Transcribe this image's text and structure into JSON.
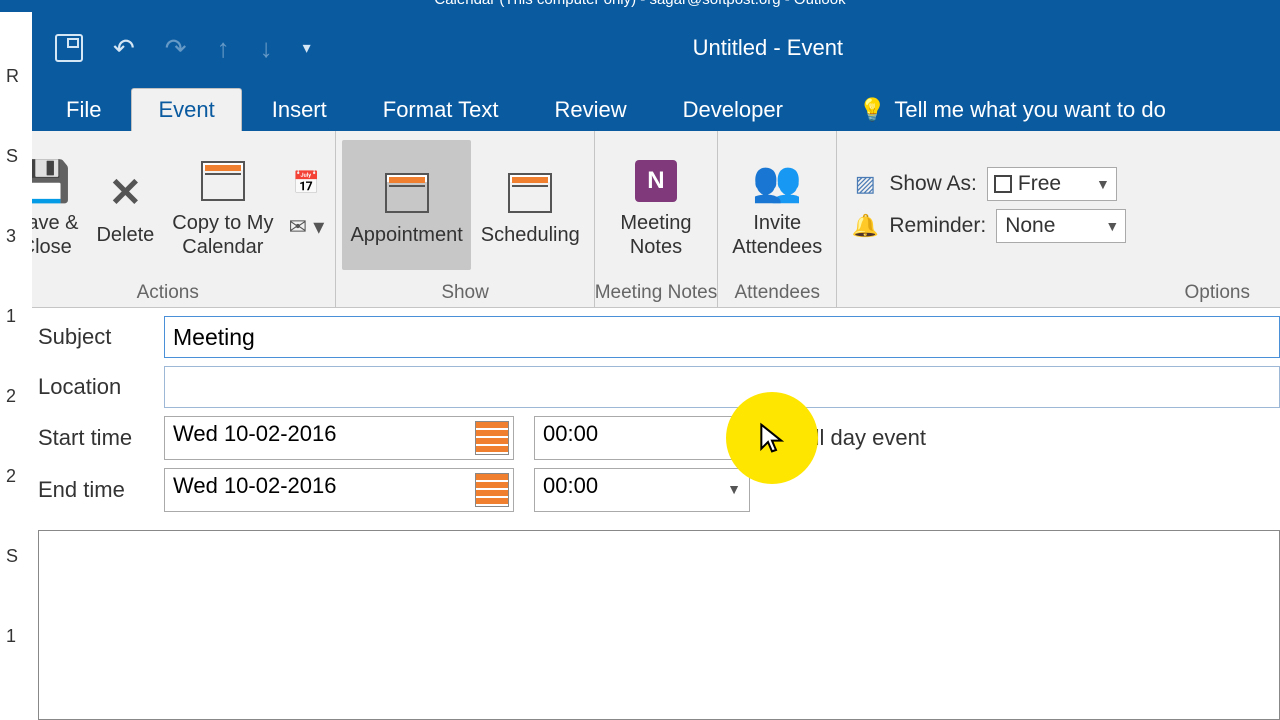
{
  "titlebar_top": "Calendar (This computer only) - sagar@softpost.org - Outlook",
  "window_title": "Untitled - Event",
  "tabs": {
    "file": "File",
    "event": "Event",
    "insert": "Insert",
    "format_text": "Format Text",
    "review": "Review",
    "developer": "Developer",
    "tell_me": "Tell me what you want to do"
  },
  "ribbon": {
    "actions": {
      "label": "Actions",
      "save_close": "Save &\nClose",
      "delete": "Delete",
      "copy_cal": "Copy to My\nCalendar"
    },
    "show": {
      "label": "Show",
      "appointment": "Appointment",
      "scheduling": "Scheduling"
    },
    "notes": {
      "label": "Meeting Notes",
      "meeting_notes": "Meeting\nNotes"
    },
    "attendees": {
      "label": "Attendees",
      "invite": "Invite\nAttendees"
    },
    "options": {
      "label": "Options",
      "show_as": "Show As:",
      "show_as_value": "Free",
      "reminder": "Reminder:",
      "reminder_value": "None"
    }
  },
  "form": {
    "subject_label": "Subject",
    "subject_value": "Meeting ",
    "location_label": "Location",
    "location_value": "",
    "start_label": "Start time",
    "start_date": "Wed 10-02-2016",
    "start_time": "00:00",
    "end_label": "End time",
    "end_date": "Wed 10-02-2016",
    "end_time": "00:00",
    "allday_label": "All day event"
  },
  "left_edge": [
    "R",
    "S",
    "3",
    "1",
    "2",
    "2",
    "S",
    "1"
  ]
}
